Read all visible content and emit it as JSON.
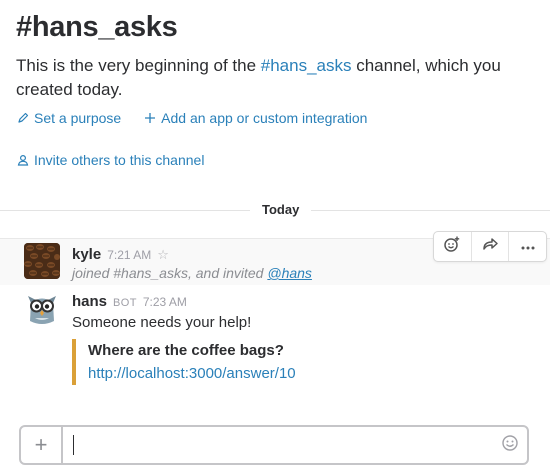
{
  "channel": {
    "title": "#hans_asks",
    "intro_prefix": "This is the very beginning of the ",
    "intro_channel": "#hans_asks",
    "intro_suffix": " channel, which you created today."
  },
  "actions": {
    "set_purpose": "Set a purpose",
    "add_app": "Add an app or custom integration",
    "invite": "Invite others to this channel"
  },
  "divider": {
    "label": "Today"
  },
  "messages": [
    {
      "author": "kyle",
      "time": "7:21 AM",
      "joined_text": "joined #hans_asks, and invited ",
      "mention": "@hans"
    },
    {
      "author": "hans",
      "badge": "BOT",
      "time": "7:23 AM",
      "text": "Someone needs your help!",
      "attachment": {
        "title": "Where are the coffee bags?",
        "link": "http://localhost:3000/answer/10",
        "color": "#daa038"
      }
    }
  ],
  "composer": {
    "value": "",
    "plus": "+"
  },
  "colors": {
    "link": "#2a80b9",
    "text": "#2c2d30",
    "muted": "#9e9ea6"
  }
}
